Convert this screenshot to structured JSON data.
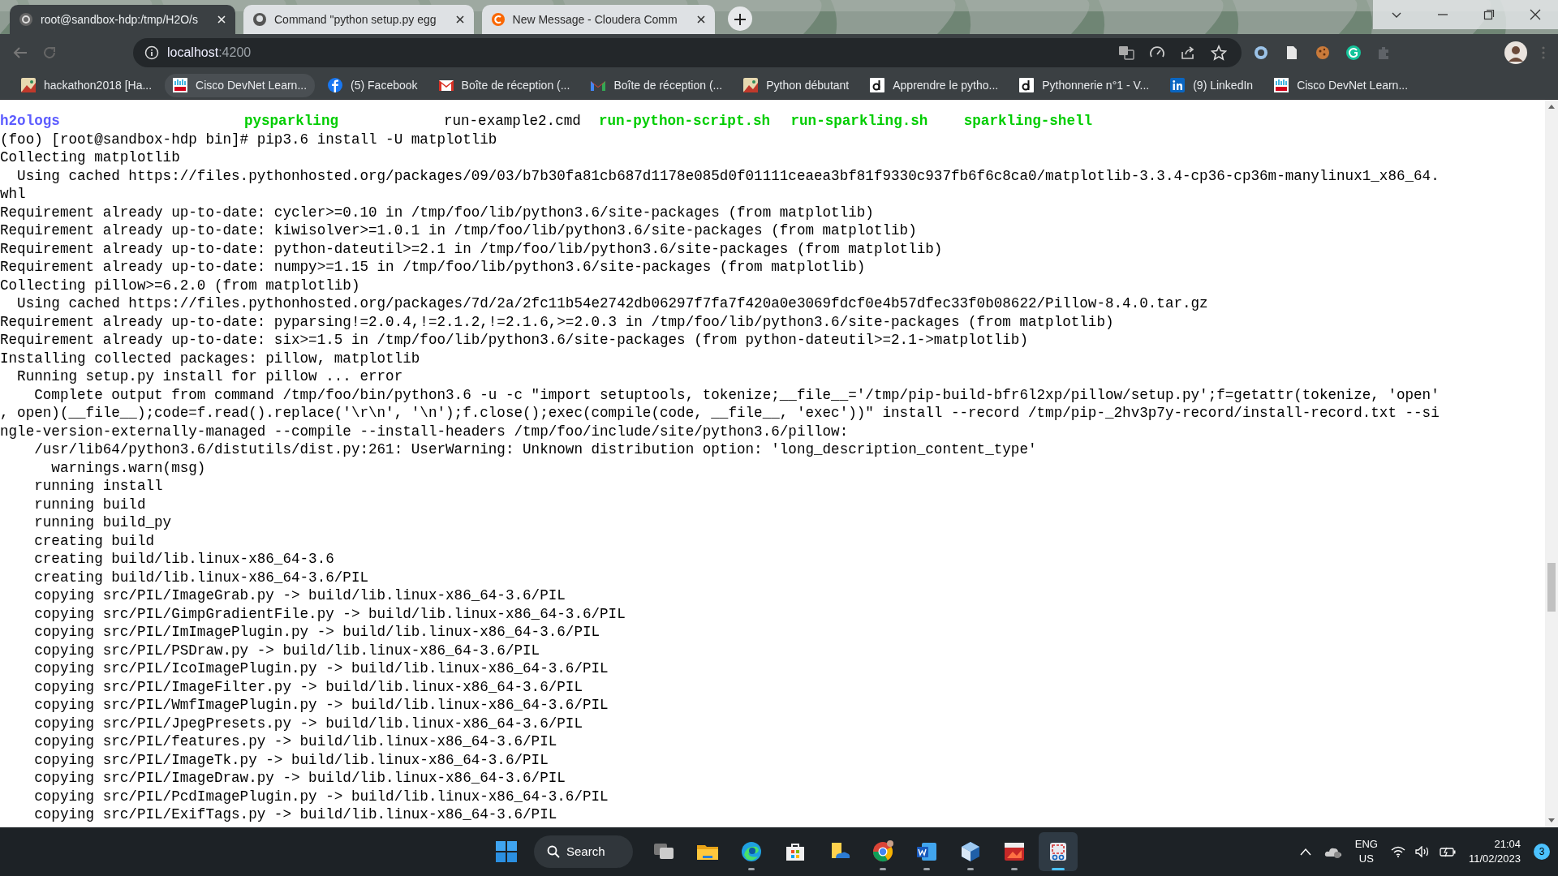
{
  "tabs": [
    {
      "title": "root@sandbox-hdp:/tmp/H2O/s",
      "selected": true
    },
    {
      "title": "Command \"python setup.py egg",
      "selected": false
    },
    {
      "title": "New Message - Cloudera Comm",
      "selected": false
    }
  ],
  "address": {
    "host": "localhost",
    "port": ":4200"
  },
  "bookmarks": [
    {
      "label": "hackathon2018 [Ha...",
      "selected": false
    },
    {
      "label": "Cisco DevNet Learn...",
      "selected": true
    },
    {
      "label": "(5) Facebook",
      "selected": false
    },
    {
      "label": "Boîte de réception (...",
      "selected": false
    },
    {
      "label": "Boîte de réception (...",
      "selected": false
    },
    {
      "label": "Python débutant",
      "selected": false
    },
    {
      "label": "Apprendre le pytho...",
      "selected": false
    },
    {
      "label": "Pythonnerie n°1 - V...",
      "selected": false
    },
    {
      "label": "(9) LinkedIn",
      "selected": false
    },
    {
      "label": "Cisco DevNet Learn...",
      "selected": false
    }
  ],
  "terminal": {
    "ls_row": [
      {
        "text": "h2ologs",
        "kind": "dir"
      },
      {
        "text": "pysparkling",
        "kind": "exec"
      },
      {
        "text": "run-example2.cmd",
        "kind": "file"
      },
      {
        "text": "run-python-script.sh",
        "kind": "exec"
      },
      {
        "text": "run-sparkling.sh",
        "kind": "exec"
      },
      {
        "text": "sparkling-shell",
        "kind": "exec"
      }
    ],
    "lines": [
      "(foo) [root@sandbox-hdp bin]# pip3.6 install -U matplotlib",
      "Collecting matplotlib",
      "  Using cached https://files.pythonhosted.org/packages/09/03/b7b30fa81cb687d1178e085d0f01111ceaea3bf81f9330c937fb6f6c8ca0/matplotlib-3.3.4-cp36-cp36m-manylinux1_x86_64.",
      "whl",
      "Requirement already up-to-date: cycler>=0.10 in /tmp/foo/lib/python3.6/site-packages (from matplotlib)",
      "Requirement already up-to-date: kiwisolver>=1.0.1 in /tmp/foo/lib/python3.6/site-packages (from matplotlib)",
      "Requirement already up-to-date: python-dateutil>=2.1 in /tmp/foo/lib/python3.6/site-packages (from matplotlib)",
      "Requirement already up-to-date: numpy>=1.15 in /tmp/foo/lib/python3.6/site-packages (from matplotlib)",
      "Collecting pillow>=6.2.0 (from matplotlib)",
      "  Using cached https://files.pythonhosted.org/packages/7d/2a/2fc11b54e2742db06297f7fa7f420a0e3069fdcf0e4b57dfec33f0b08622/Pillow-8.4.0.tar.gz",
      "Requirement already up-to-date: pyparsing!=2.0.4,!=2.1.2,!=2.1.6,>=2.0.3 in /tmp/foo/lib/python3.6/site-packages (from matplotlib)",
      "Requirement already up-to-date: six>=1.5 in /tmp/foo/lib/python3.6/site-packages (from python-dateutil>=2.1->matplotlib)",
      "Installing collected packages: pillow, matplotlib",
      "  Running setup.py install for pillow ... error",
      "    Complete output from command /tmp/foo/bin/python3.6 -u -c \"import setuptools, tokenize;__file__='/tmp/pip-build-bfr6l2xp/pillow/setup.py';f=getattr(tokenize, 'open'",
      ", open)(__file__);code=f.read().replace('\\r\\n', '\\n');f.close();exec(compile(code, __file__, 'exec'))\" install --record /tmp/pip-_2hv3p7y-record/install-record.txt --si",
      "ngle-version-externally-managed --compile --install-headers /tmp/foo/include/site/python3.6/pillow:",
      "    /usr/lib64/python3.6/distutils/dist.py:261: UserWarning: Unknown distribution option: 'long_description_content_type'",
      "      warnings.warn(msg)",
      "    running install",
      "    running build",
      "    running build_py",
      "    creating build",
      "    creating build/lib.linux-x86_64-3.6",
      "    creating build/lib.linux-x86_64-3.6/PIL",
      "    copying src/PIL/ImageGrab.py -> build/lib.linux-x86_64-3.6/PIL",
      "    copying src/PIL/GimpGradientFile.py -> build/lib.linux-x86_64-3.6/PIL",
      "    copying src/PIL/ImImagePlugin.py -> build/lib.linux-x86_64-3.6/PIL",
      "    copying src/PIL/PSDraw.py -> build/lib.linux-x86_64-3.6/PIL",
      "    copying src/PIL/IcoImagePlugin.py -> build/lib.linux-x86_64-3.6/PIL",
      "    copying src/PIL/ImageFilter.py -> build/lib.linux-x86_64-3.6/PIL",
      "    copying src/PIL/WmfImagePlugin.py -> build/lib.linux-x86_64-3.6/PIL",
      "    copying src/PIL/JpegPresets.py -> build/lib.linux-x86_64-3.6/PIL",
      "    copying src/PIL/features.py -> build/lib.linux-x86_64-3.6/PIL",
      "    copying src/PIL/ImageTk.py -> build/lib.linux-x86_64-3.6/PIL",
      "    copying src/PIL/ImageDraw.py -> build/lib.linux-x86_64-3.6/PIL",
      "    copying src/PIL/PcdImagePlugin.py -> build/lib.linux-x86_64-3.6/PIL",
      "    copying src/PIL/ExifTags.py -> build/lib.linux-x86_64-3.6/PIL"
    ]
  },
  "taskbar": {
    "search": "Search",
    "apps": [
      {
        "kind": "taskview",
        "running": false,
        "active": false
      },
      {
        "kind": "explorer",
        "running": false,
        "active": false
      },
      {
        "kind": "edge",
        "running": true,
        "active": false
      },
      {
        "kind": "store",
        "running": false,
        "active": false
      },
      {
        "kind": "files",
        "running": false,
        "active": false
      },
      {
        "kind": "chrome",
        "running": true,
        "active": false
      },
      {
        "kind": "word",
        "running": true,
        "active": false
      },
      {
        "kind": "cube",
        "running": true,
        "active": false
      },
      {
        "kind": "redapp",
        "running": true,
        "active": false
      },
      {
        "kind": "snip",
        "running": true,
        "active": true
      }
    ],
    "lang": "ENG",
    "region": "US",
    "time": "21:04",
    "date": "11/02/2023",
    "notifications": "3"
  }
}
